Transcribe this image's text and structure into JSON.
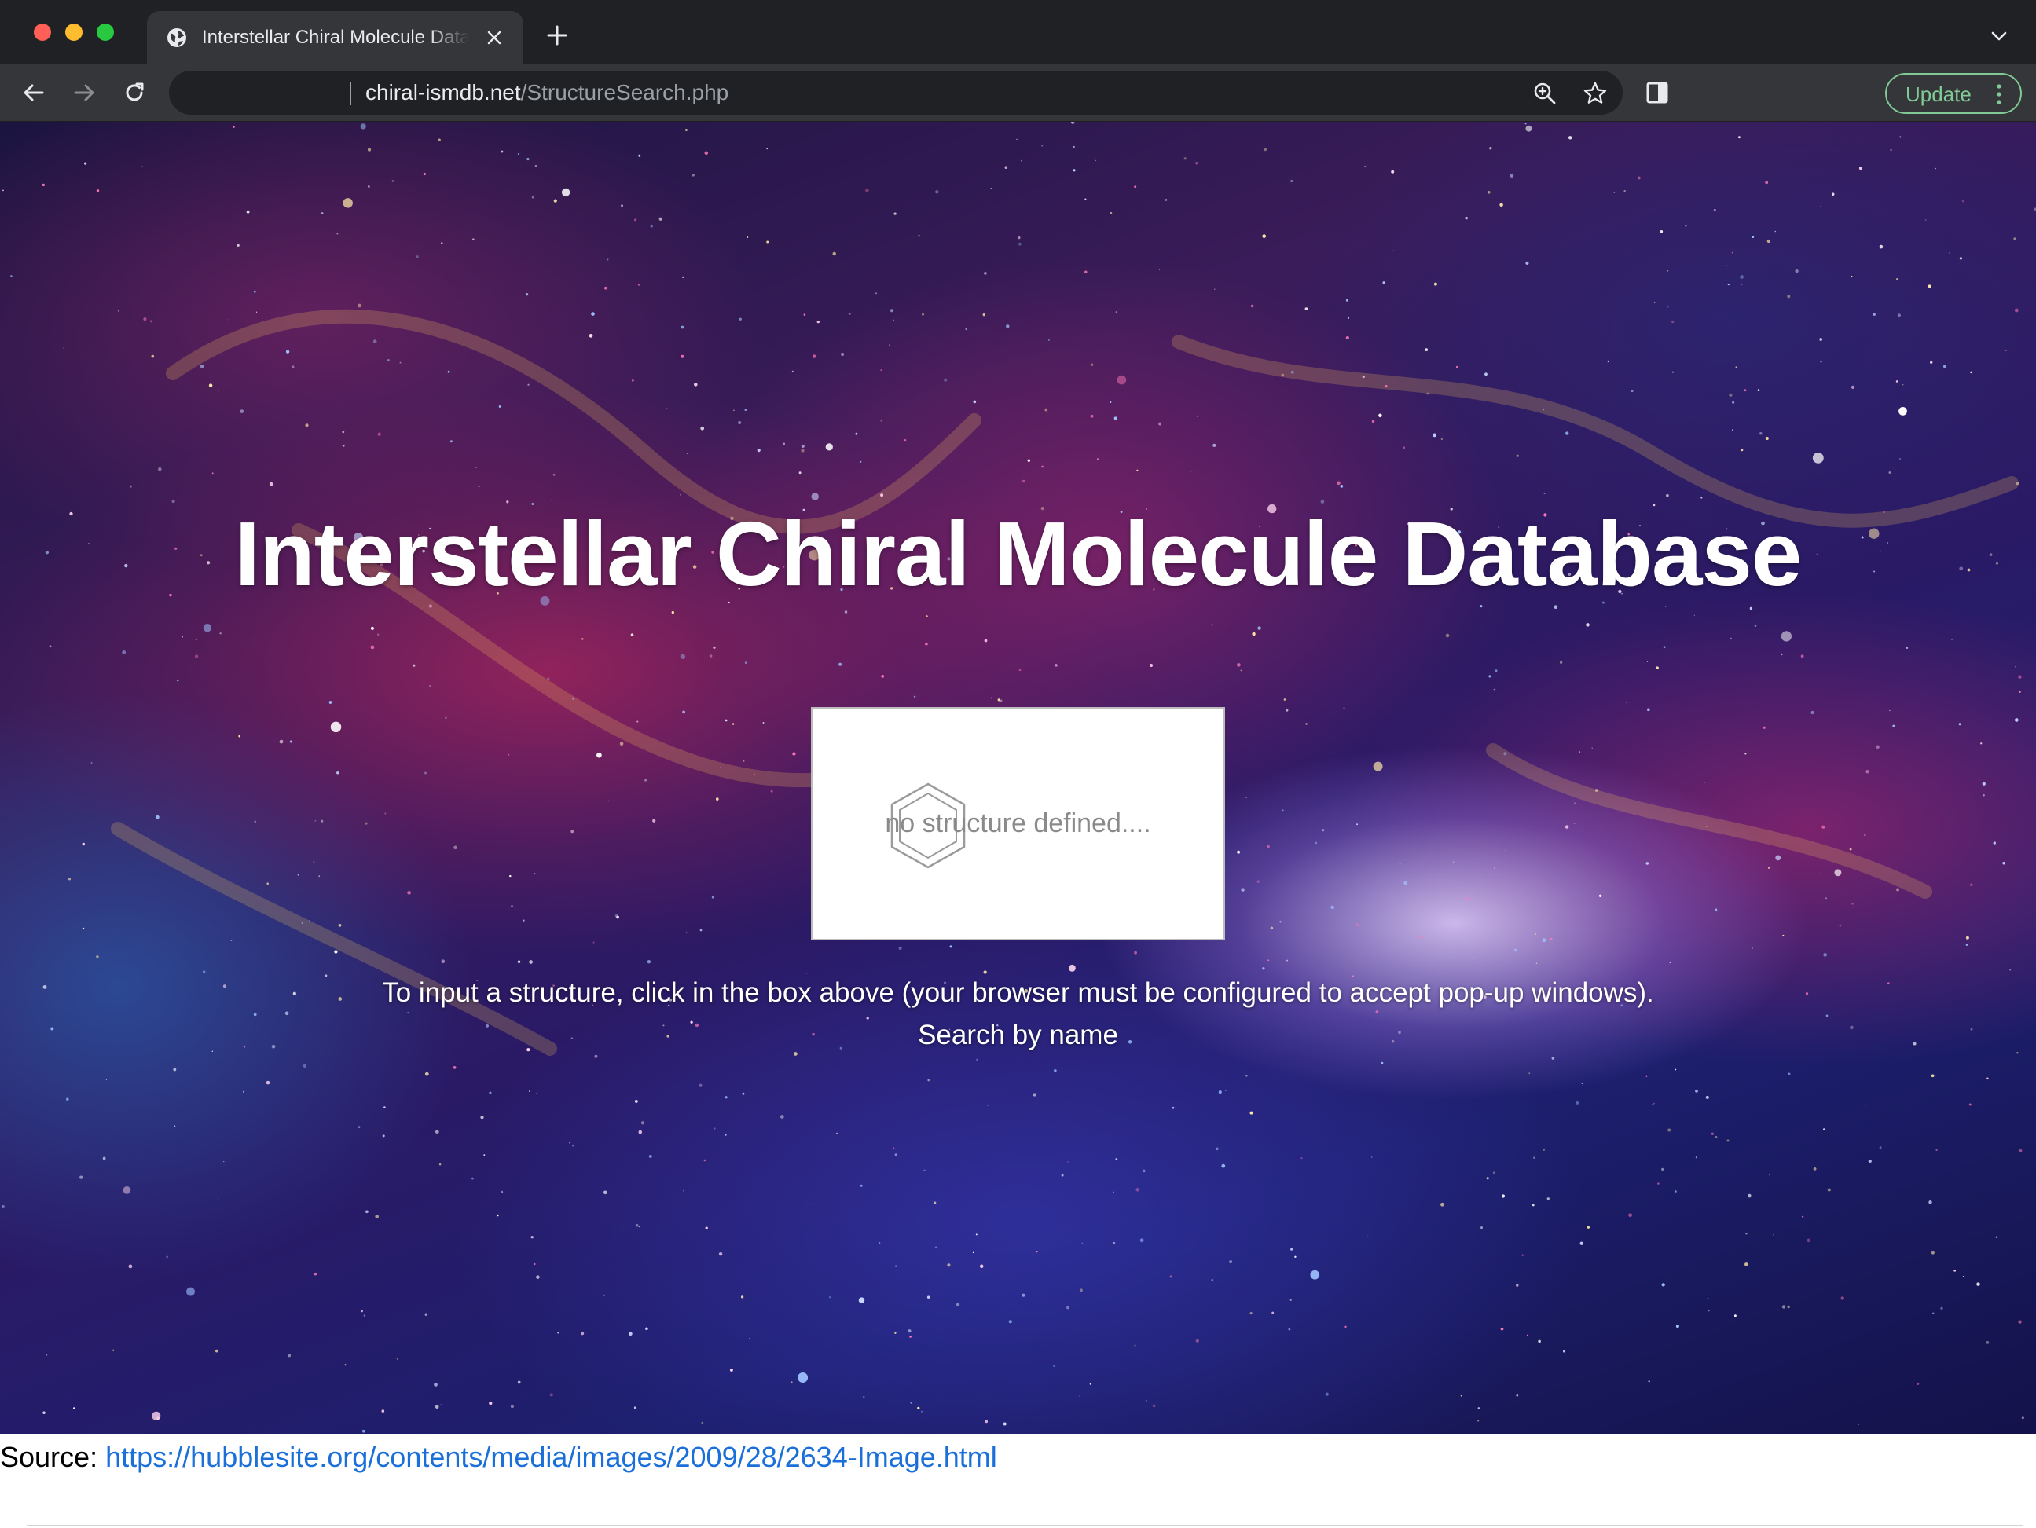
{
  "browser": {
    "tab_title": "Interstellar Chiral Molecule Database",
    "url_host": "chiral-ismdb.net",
    "url_path": "/StructureSearch.php",
    "update_label": "Update",
    "icons": {
      "favicon": "globe-icon",
      "close": "close-icon",
      "new_tab": "plus-icon",
      "tab_menu": "chevron-down-icon",
      "back": "arrow-left-icon",
      "forward": "arrow-right-icon",
      "reload": "reload-icon",
      "zoom": "zoom-icon",
      "bookmark": "star-icon",
      "side_panel": "side-panel-icon",
      "more": "vertical-dots-icon"
    },
    "colors": {
      "tabstrip": "#202124",
      "toolbar": "#35363a",
      "update_accent": "#81c995"
    }
  },
  "page": {
    "title": "Interstellar Chiral Molecule Database",
    "structure_placeholder": "no structure defined....",
    "structure_icon": "benzene-ring-icon",
    "instruction": "To input a structure, click in the box above (your browser must be configured to accept pop-up windows).",
    "search_by_name": "Search by name",
    "background": "galaxy-image",
    "source_label": "Source:",
    "source_url": "https://hubblesite.org/contents/media/images/2009/28/2634-Image.html",
    "colors": {
      "title": "#ffffff",
      "link": "#1a6fd8"
    }
  }
}
